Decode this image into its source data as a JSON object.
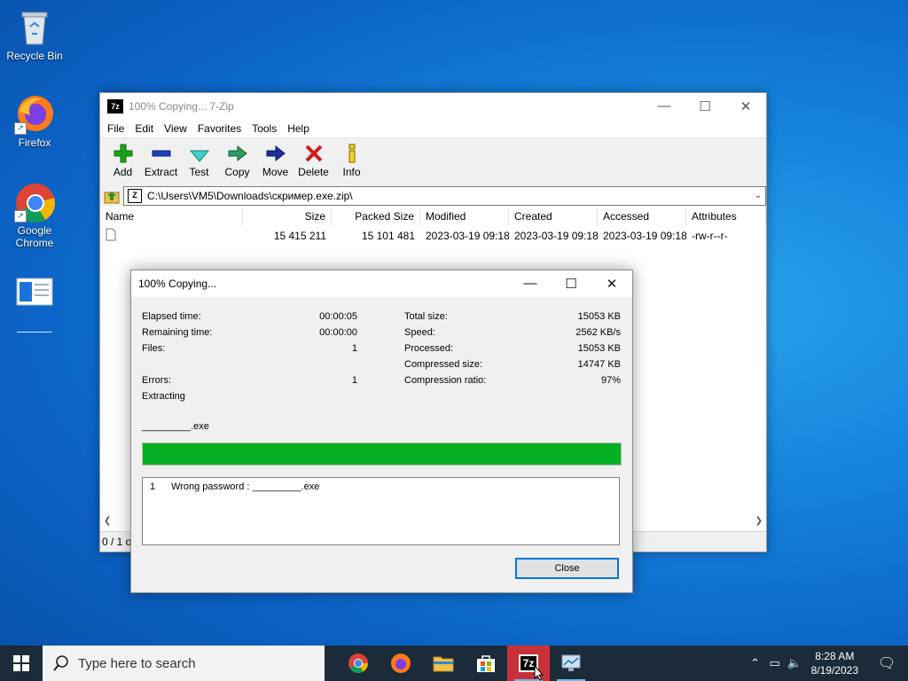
{
  "desktop": {
    "icons": [
      {
        "label": "Recycle Bin"
      },
      {
        "label": "Firefox"
      },
      {
        "label": "Google Chrome"
      },
      {
        "label": ""
      }
    ]
  },
  "main_window": {
    "title": "100% Copying... 7-Zip",
    "app_icon_text": "7z",
    "menu": [
      "File",
      "Edit",
      "View",
      "Favorites",
      "Tools",
      "Help"
    ],
    "toolbar": [
      "Add",
      "Extract",
      "Test",
      "Copy",
      "Move",
      "Delete",
      "Info"
    ],
    "address": "C:\\Users\\VM5\\Downloads\\скример.exe.zip\\",
    "columns": [
      "Name",
      "Size",
      "Packed Size",
      "Modified",
      "Created",
      "Accessed",
      "Attributes"
    ],
    "rows": [
      {
        "name": "",
        "size": "15 415 211",
        "packed": "15 101 481",
        "modified": "2023-03-19 09:18",
        "created": "2023-03-19 09:18",
        "accessed": "2023-03-19 09:18",
        "attr": "-rw-r--r-"
      }
    ],
    "status": "0 / 1 o"
  },
  "progress_dialog": {
    "title": "100% Copying...",
    "left_stats": [
      {
        "label": "Elapsed time:",
        "value": "00:00:05"
      },
      {
        "label": "Remaining time:",
        "value": "00:00:00"
      },
      {
        "label": "Files:",
        "value": "1"
      },
      {
        "label": "",
        "value": ""
      },
      {
        "label": "Errors:",
        "value": "1"
      }
    ],
    "right_stats": [
      {
        "label": "Total size:",
        "value": "15053 KB"
      },
      {
        "label": "Speed:",
        "value": "2562 KB/s"
      },
      {
        "label": "Processed:",
        "value": "15053 KB"
      },
      {
        "label": "Compressed size:",
        "value": "14747 KB"
      },
      {
        "label": "Compression ratio:",
        "value": "97%"
      }
    ],
    "operation": "Extracting",
    "current_file": "_________.exe",
    "progress_fraction": 1.0,
    "messages": [
      {
        "num": "1",
        "text": "Wrong password : _________.exe"
      }
    ],
    "close_label": "Close"
  },
  "taskbar": {
    "search_placeholder": "Type here to search",
    "apps": [
      "chrome-icon",
      "firefox-icon",
      "file-explorer-icon",
      "store-icon",
      "7zip-icon",
      "control-panel-icon"
    ],
    "active_app_label": "7z",
    "time": "8:28 AM",
    "date": "8/19/2023"
  },
  "colors": {
    "progress": "#06b025",
    "active_task": "#c9313a",
    "accent": "#0078d7"
  }
}
